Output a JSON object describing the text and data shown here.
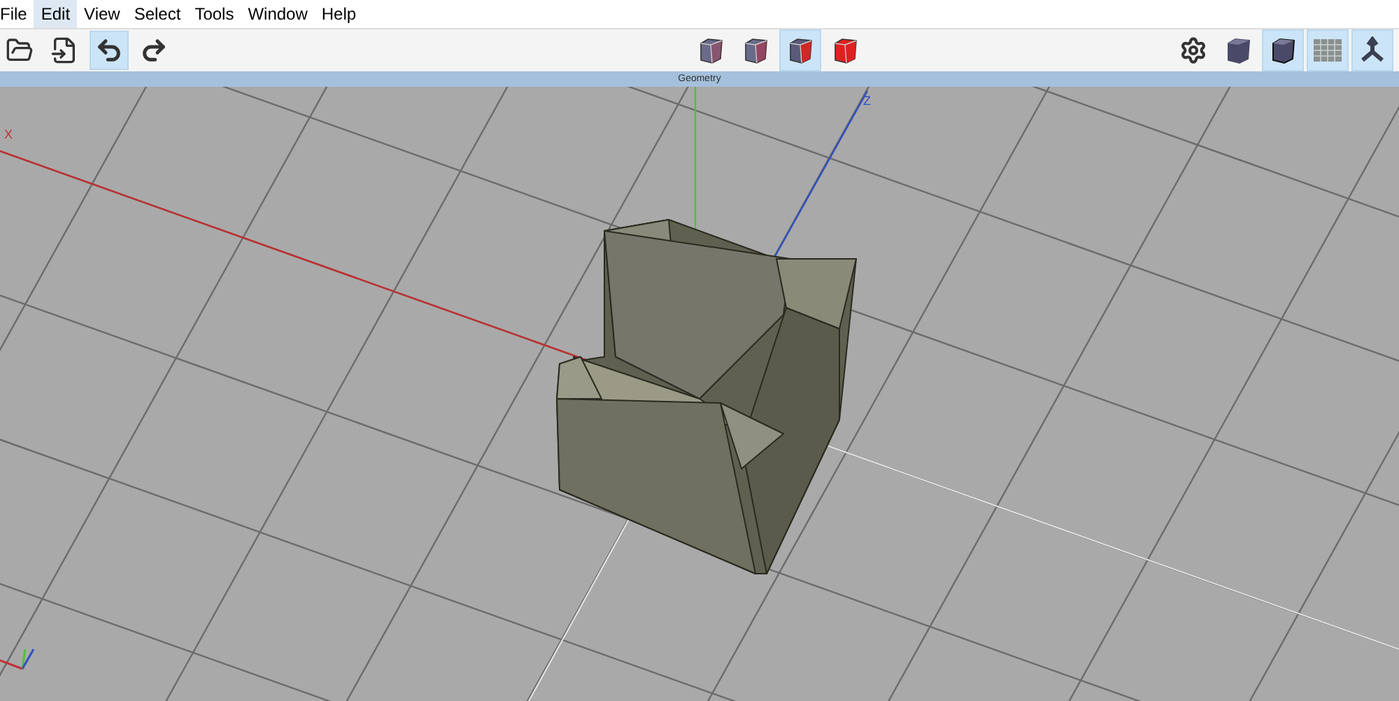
{
  "menu": [
    {
      "label": "File",
      "selected": false
    },
    {
      "label": "Edit",
      "selected": true
    },
    {
      "label": "View",
      "selected": false
    },
    {
      "label": "Select",
      "selected": false
    },
    {
      "label": "Tools",
      "selected": false
    },
    {
      "label": "Window",
      "selected": false
    },
    {
      "label": "Help",
      "selected": false
    }
  ],
  "toolbar_left": [
    {
      "kind": "open",
      "selected": false
    },
    {
      "kind": "import",
      "selected": false
    },
    {
      "kind": "undo",
      "selected": true
    },
    {
      "kind": "redo",
      "selected": false
    }
  ],
  "view_modes": [
    {
      "kind": "wireframe",
      "selected": false
    },
    {
      "kind": "hidden",
      "selected": false
    },
    {
      "kind": "xray",
      "selected": true
    },
    {
      "kind": "solid",
      "selected": false
    }
  ],
  "toolbar_right": [
    {
      "kind": "settings",
      "selected": false
    },
    {
      "kind": "shaded",
      "selected": false
    },
    {
      "kind": "shaded-edges",
      "selected": true
    },
    {
      "kind": "grid",
      "selected": true
    },
    {
      "kind": "axes",
      "selected": true
    }
  ],
  "panel": {
    "title": "Geometry"
  },
  "viewport": {
    "axis_labels": [
      {
        "kind": "x",
        "label": "X"
      },
      {
        "kind": "z",
        "label": "Z"
      }
    ]
  }
}
